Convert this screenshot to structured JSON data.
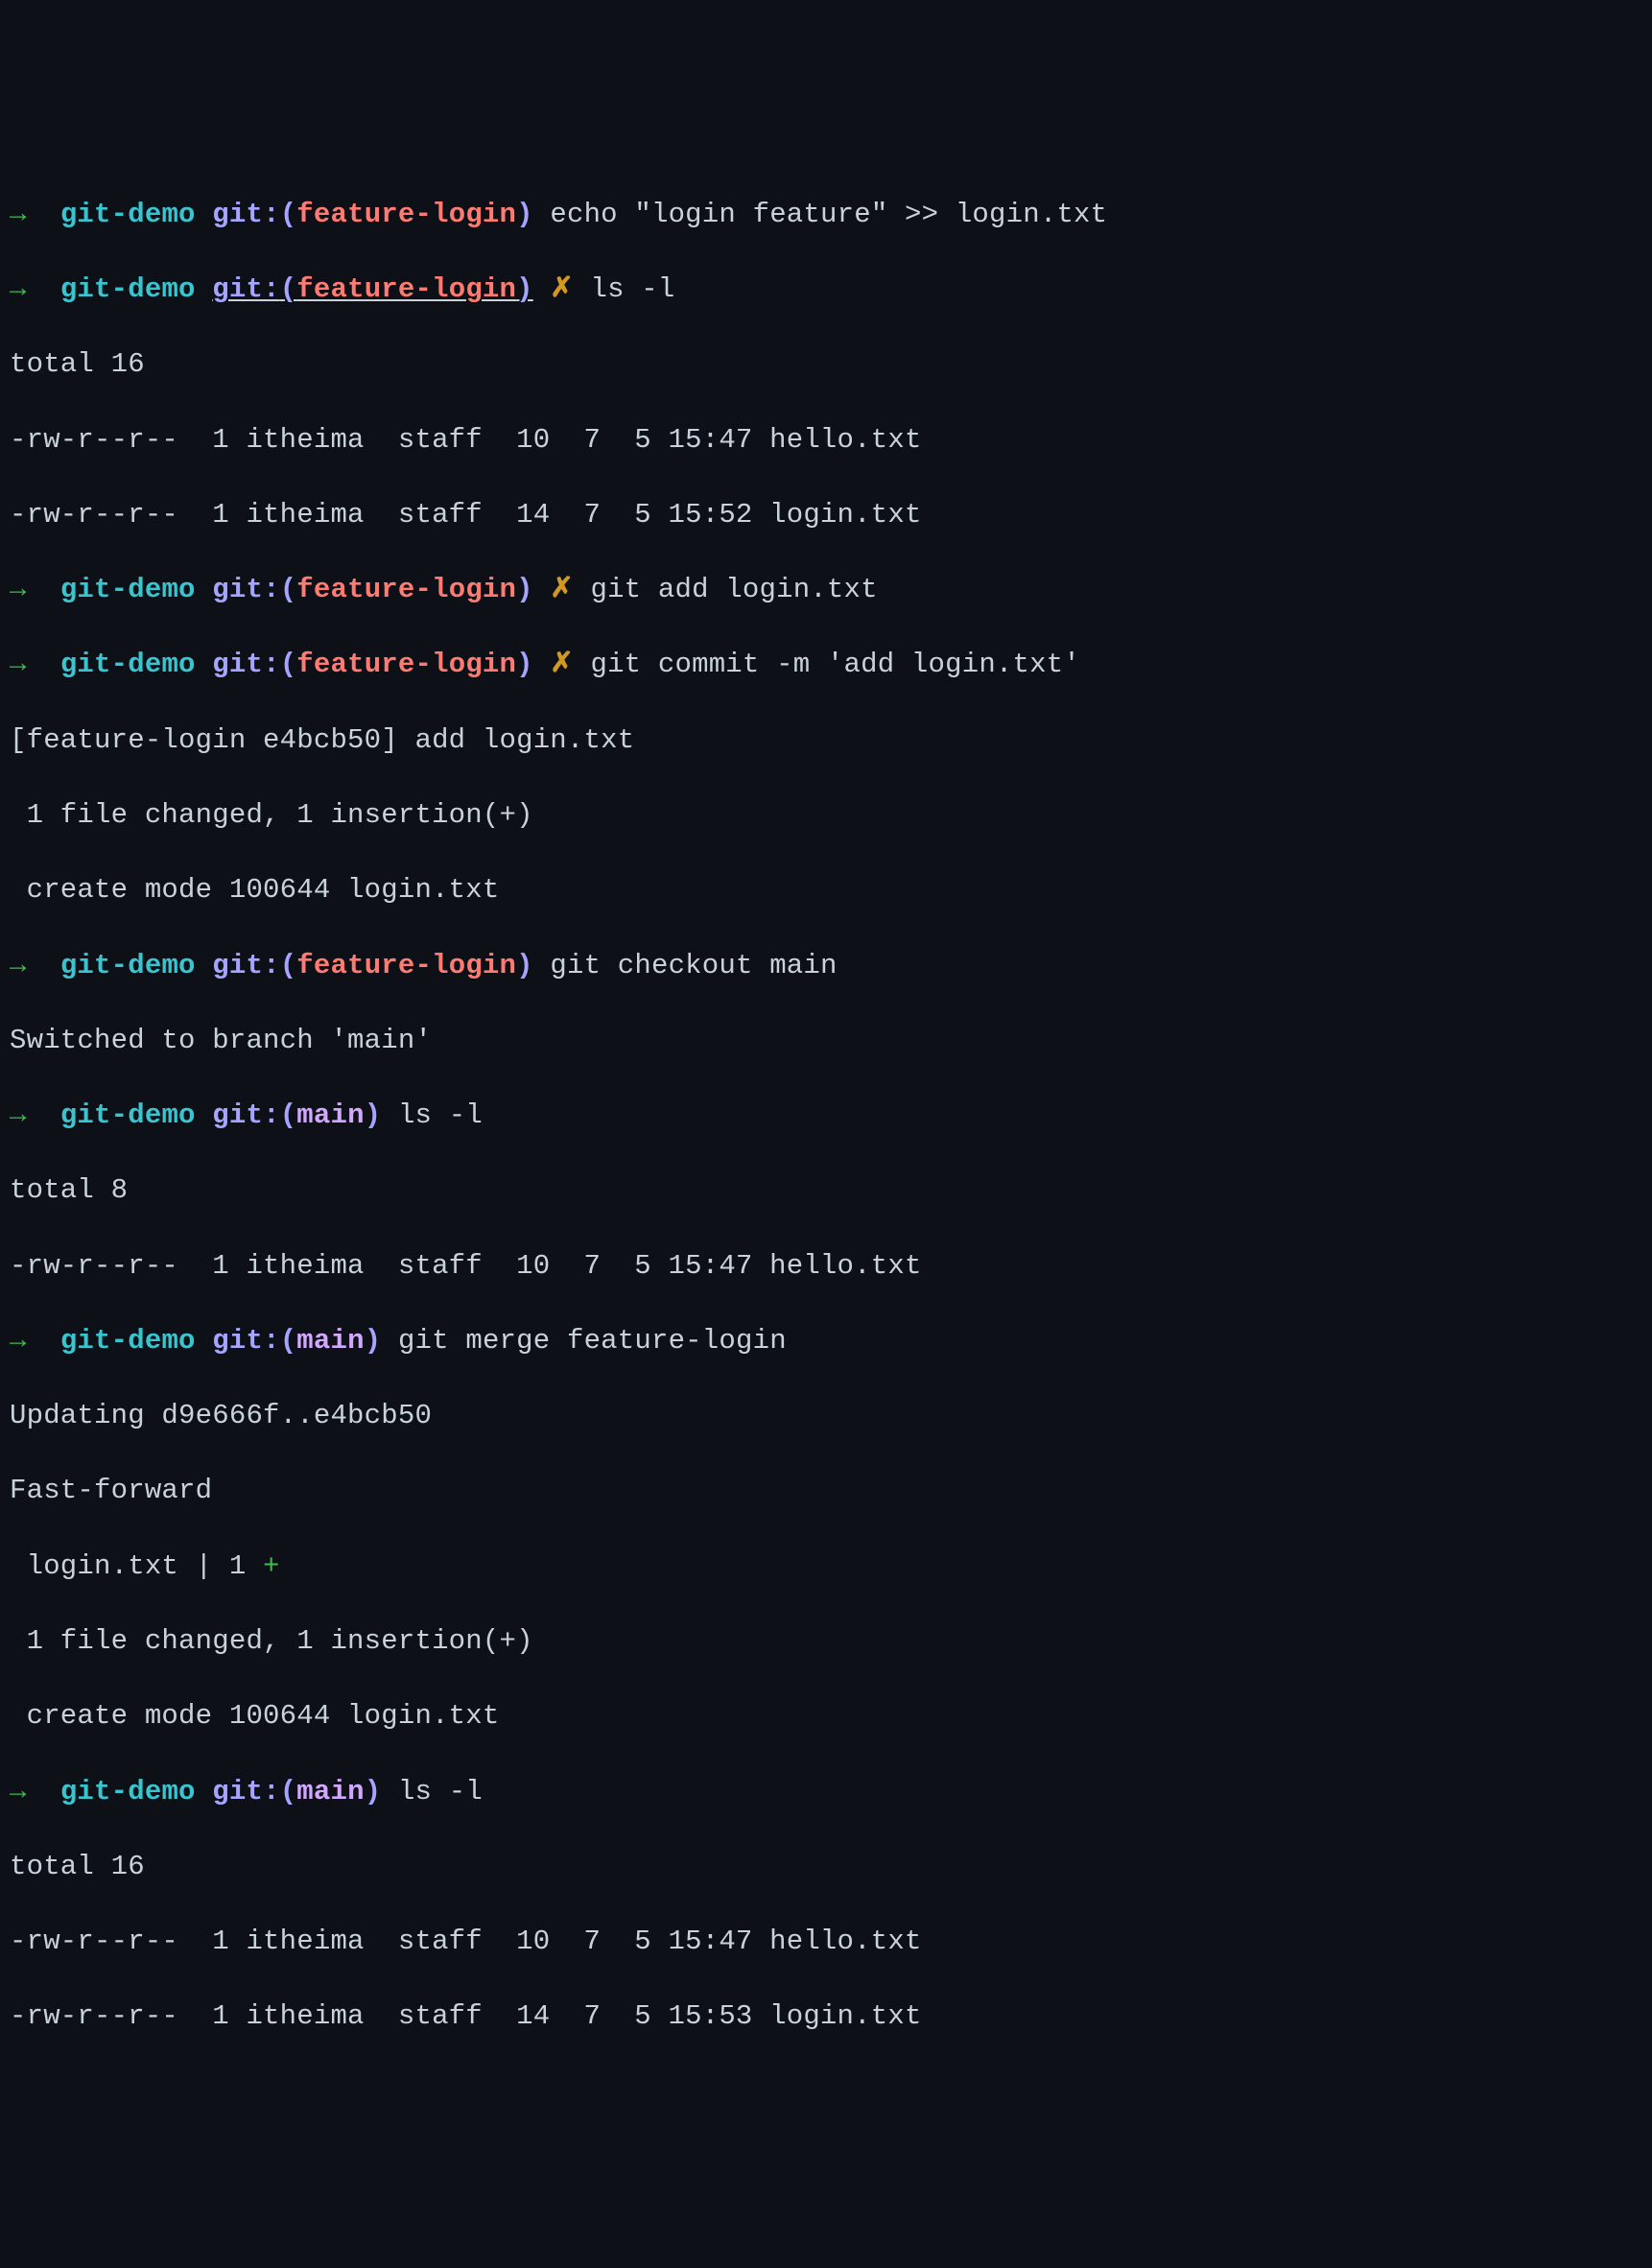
{
  "colors": {
    "bg": "#0d1117",
    "fg": "#c9d1d9",
    "arrow": "#3fb950",
    "dir": "#39c5cf",
    "git_label": "#a5a5ff",
    "branch_feature": "#ff7b72",
    "branch_main": "#d2a8ff",
    "dirty": "#d29922",
    "plus": "#3fb950"
  },
  "prompt": {
    "arrow": "→",
    "dir": "git-demo",
    "git_label": "git:",
    "paren_open": "(",
    "paren_close": ")",
    "dirty_mark": "✗",
    "branch_feature": "feature-login",
    "branch_main": "main"
  },
  "commands": {
    "c1": "echo \"login feature\" >> login.txt",
    "c2": "ls -l",
    "c3": "git add login.txt",
    "c4": "git commit -m 'add login.txt'",
    "c5": "git checkout main",
    "c6": "ls -l",
    "c7": "git merge feature-login",
    "c8": "ls -l"
  },
  "output": {
    "ls1_total": "total 16",
    "ls1_row1": "-rw-r--r--  1 itheima  staff  10  7  5 15:47 hello.txt",
    "ls1_row2": "-rw-r--r--  1 itheima  staff  14  7  5 15:52 login.txt",
    "commit1": "[feature-login e4bcb50] add login.txt",
    "commit2": " 1 file changed, 1 insertion(+)",
    "commit3": " create mode 100644 login.txt",
    "switched": "Switched to branch 'main'",
    "ls2_total": "total 8",
    "ls2_row1": "-rw-r--r--  1 itheima  staff  10  7  5 15:47 hello.txt",
    "merge1": "Updating d9e666f..e4bcb50",
    "merge2": "Fast-forward",
    "merge3a": " login.txt | 1 ",
    "merge3b": "+",
    "merge4": " 1 file changed, 1 insertion(+)",
    "merge5": " create mode 100644 login.txt",
    "ls3_total": "total 16",
    "ls3_row1": "-rw-r--r--  1 itheima  staff  10  7  5 15:47 hello.txt",
    "ls3_row2": "-rw-r--r--  1 itheima  staff  14  7  5 15:53 login.txt"
  }
}
